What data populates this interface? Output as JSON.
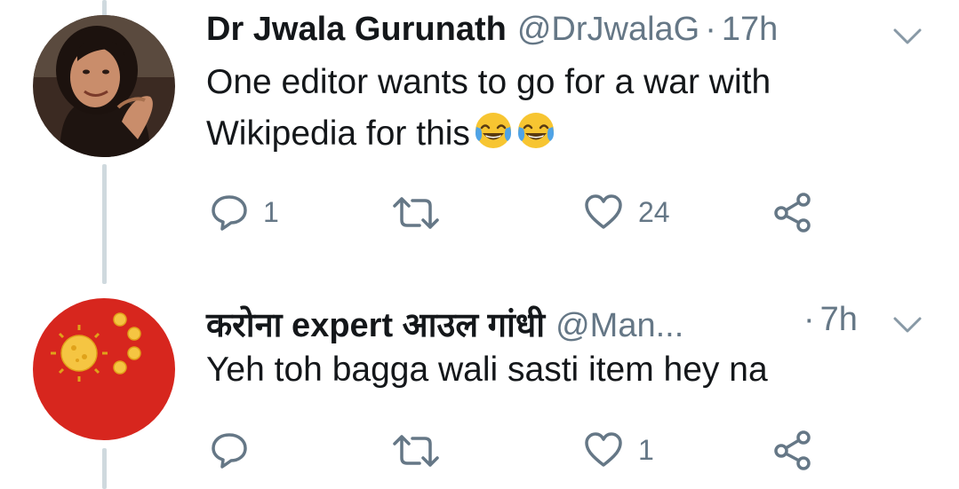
{
  "tweets": [
    {
      "name": "Dr Jwala Gurunath",
      "handle": "@DrJwalaG",
      "separator": "·",
      "time": "17h",
      "text_line1": "One editor wants to go for a war with",
      "text_line2": "Wikipedia for this",
      "emoji": "face-with-tears-of-joy",
      "replies": "1",
      "likes": "24"
    },
    {
      "name": "करोना expert आउल गांधी",
      "handle": "@Man...",
      "separator": "·",
      "time": "7h",
      "text_line1": "Yeh toh bagga wali sasti item hey na",
      "replies": "",
      "likes": "1"
    }
  ],
  "colors": {
    "text": "#14171a",
    "secondary": "#657786",
    "thread_line": "#cfd9de",
    "avatar2_red": "#d7261e",
    "avatar2_virus": "#f5c542"
  },
  "icons": [
    "reply-icon",
    "retweet-icon",
    "like-icon",
    "share-icon",
    "chevron-down-icon"
  ]
}
